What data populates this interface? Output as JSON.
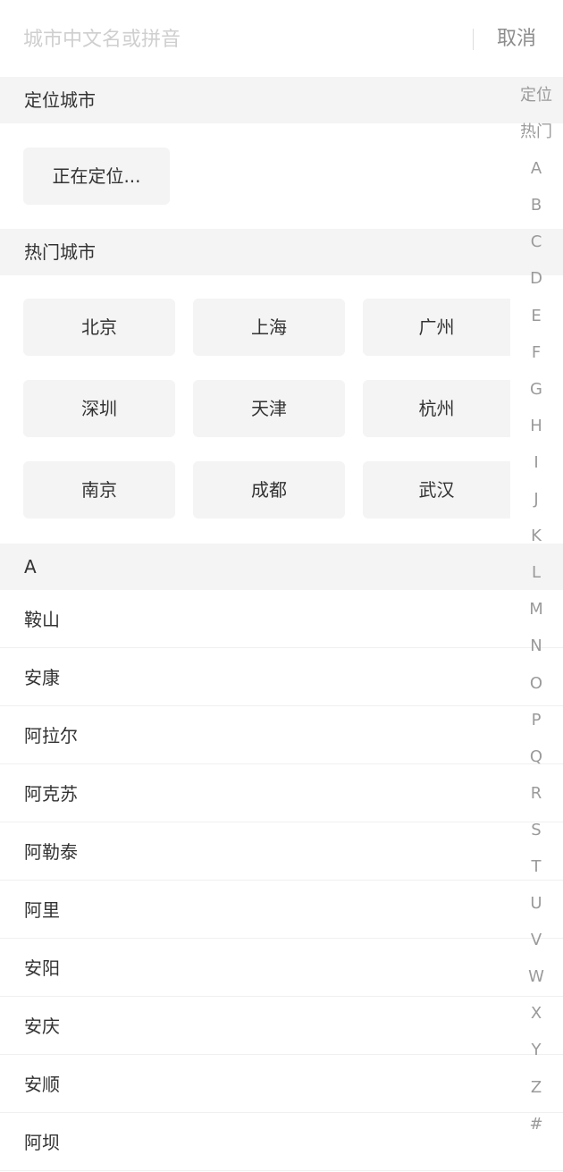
{
  "search": {
    "placeholder": "城市中文名或拼音",
    "value": "",
    "cancel_label": "取消"
  },
  "location_section": {
    "title": "定位城市",
    "status": "正在定位..."
  },
  "hot_section": {
    "title": "热门城市",
    "cities": [
      "北京",
      "上海",
      "广州",
      "深圳",
      "天津",
      "杭州",
      "南京",
      "成都",
      "武汉"
    ]
  },
  "group_a": {
    "letter": "A",
    "cities": [
      "鞍山",
      "安康",
      "阿拉尔",
      "阿克苏",
      "阿勒泰",
      "阿里",
      "安阳",
      "安庆",
      "安顺",
      "阿坝"
    ]
  },
  "index_bar": [
    "定位",
    "热门",
    "A",
    "B",
    "C",
    "D",
    "E",
    "F",
    "G",
    "H",
    "I",
    "J",
    "K",
    "L",
    "M",
    "N",
    "O",
    "P",
    "Q",
    "R",
    "S",
    "T",
    "U",
    "V",
    "W",
    "X",
    "Y",
    "Z",
    "#"
  ]
}
